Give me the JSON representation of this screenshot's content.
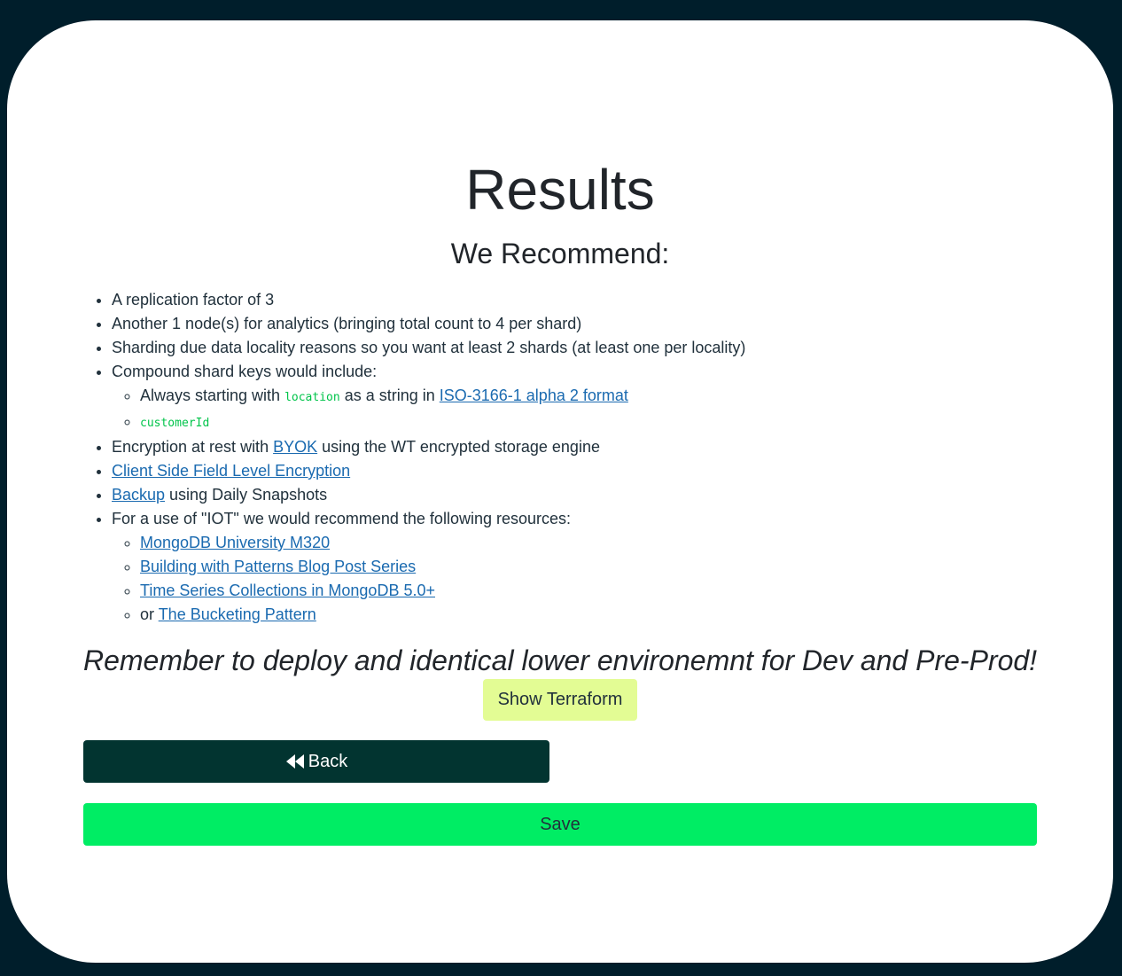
{
  "page": {
    "title": "Results",
    "subtitle": "We Recommend:"
  },
  "recommendations": {
    "replication": "A replication factor of 3",
    "analytics": "Another 1 node(s) for analytics (bringing total count to 4 per shard)",
    "sharding": "Sharding due data locality reasons so you want at least 2 shards (at least one per locality)",
    "shard_keys": {
      "intro": "Compound shard keys would include:",
      "location_prefix": "Always starting with ",
      "location_code": "location",
      "location_middle": " as a string in ",
      "location_link": "ISO-3166-1 alpha 2 format",
      "customer_code": "customerId"
    },
    "encryption": {
      "prefix": "Encryption at rest with ",
      "link": "BYOK",
      "suffix": " using the WT encrypted storage engine"
    },
    "csfle_link": "Client Side Field Level Encryption",
    "backup": {
      "link": "Backup",
      "suffix": " using Daily Snapshots"
    },
    "resources": {
      "intro": "For a use of \"IOT\" we would recommend the following resources:",
      "items": [
        "MongoDB University M320",
        "Building with Patterns Blog Post Series",
        "Time Series Collections in MongoDB 5.0+"
      ],
      "last_prefix": "or ",
      "last_link": "The Bucketing Pattern"
    }
  },
  "reminder": "Remember to deploy and identical lower environemnt for Dev and Pre-Prod!",
  "buttons": {
    "terraform": "Show Terraform",
    "back": "Back",
    "back_icon": "fast-backward-icon",
    "save": "Save"
  },
  "colors": {
    "background": "#001e2b",
    "card": "#ffffff",
    "link": "#1a6ab0",
    "code": "#00c44a",
    "terraform_button": "#e3fc94",
    "back_button": "#023430",
    "save_button": "#00ed64"
  }
}
